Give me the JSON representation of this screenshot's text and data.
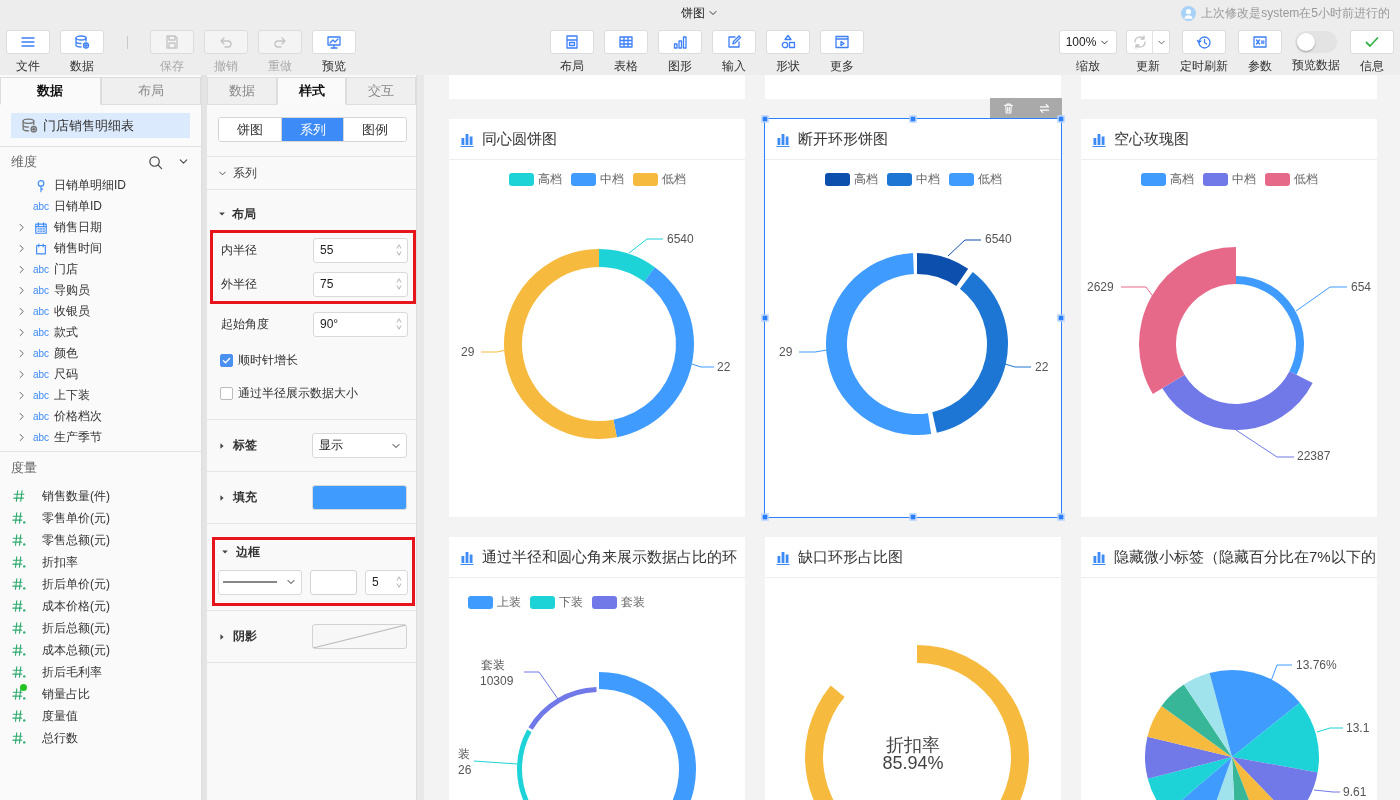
{
  "header": {
    "title": "饼图",
    "last_modified": "上次修改是system在5小时前进行的"
  },
  "toolbar": {
    "left_groups": [
      [
        {
          "kind": "menu",
          "label": "文件",
          "disabled": false
        },
        {
          "kind": "database",
          "label": "数据",
          "disabled": false
        }
      ],
      [
        {
          "kind": "save",
          "label": "保存",
          "disabled": true
        },
        {
          "kind": "undo",
          "label": "撤销",
          "disabled": true
        },
        {
          "kind": "redo",
          "label": "重做",
          "disabled": true
        },
        {
          "kind": "preview",
          "label": "预览",
          "disabled": false
        }
      ]
    ],
    "center": [
      {
        "kind": "layout",
        "label": "布局",
        "disabled": false
      },
      {
        "kind": "table",
        "label": "表格",
        "disabled": false
      },
      {
        "kind": "chart",
        "label": "图形",
        "disabled": false
      },
      {
        "kind": "edit",
        "label": "输入",
        "disabled": false
      },
      {
        "kind": "shapes",
        "label": "形状",
        "disabled": false
      },
      {
        "kind": "more",
        "label": "更多",
        "disabled": false
      }
    ],
    "right": [
      {
        "kind": "dropdown",
        "value": "100%",
        "label": "缩放"
      },
      {
        "kind": "split",
        "label": "更新",
        "disabled": true
      },
      {
        "kind": "clock",
        "label": "定时刷新",
        "disabled": false
      },
      {
        "kind": "formula",
        "label": "参数",
        "disabled": false
      },
      {
        "kind": "toggle",
        "label": "预览数据",
        "on": false
      },
      {
        "kind": "check",
        "label": "信息",
        "disabled": false
      }
    ]
  },
  "data_panel": {
    "tabs": [
      {
        "label": "数据",
        "selected": true
      },
      {
        "label": "布局",
        "selected": false
      }
    ],
    "dataset": {
      "name": "门店销售明细表",
      "selected": true
    },
    "dimensions": {
      "title": "维度",
      "items": [
        {
          "name": "日销单明细ID",
          "kind": "key",
          "expandable": false
        },
        {
          "name": "日销单ID",
          "type_label": "abc",
          "expandable": false
        },
        {
          "name": "销售日期",
          "kind": "calendar",
          "expandable": true
        },
        {
          "name": "销售时间",
          "kind": "time",
          "expandable": true
        },
        {
          "name": "门店",
          "type_label": "abc",
          "expandable": true
        },
        {
          "name": "导购员",
          "type_label": "abc",
          "expandable": true
        },
        {
          "name": "收银员",
          "type_label": "abc",
          "expandable": true
        },
        {
          "name": "款式",
          "type_label": "abc",
          "expandable": true
        },
        {
          "name": "颜色",
          "type_label": "abc",
          "expandable": true
        },
        {
          "name": "尺码",
          "type_label": "abc",
          "expandable": true
        },
        {
          "name": "上下装",
          "type_label": "abc",
          "expandable": true
        },
        {
          "name": "价格档次",
          "type_label": "abc",
          "expandable": true
        },
        {
          "name": "生产季节",
          "type_label": "abc",
          "expandable": true
        }
      ]
    },
    "measures": {
      "title": "度量",
      "items": [
        {
          "name": "销售数量(件)",
          "kind": "hash",
          "flagged": false
        },
        {
          "name": "零售单价(元)",
          "kind": "hash-dot",
          "flagged": false
        },
        {
          "name": "零售总额(元)",
          "kind": "hash-dot",
          "flagged": false
        },
        {
          "name": "折扣率",
          "kind": "hash-dot",
          "flagged": false
        },
        {
          "name": "折后单价(元)",
          "kind": "hash-dot",
          "flagged": false
        },
        {
          "name": "成本价格(元)",
          "kind": "hash-dot",
          "flagged": false
        },
        {
          "name": "折后总额(元)",
          "kind": "hash-dot",
          "flagged": false
        },
        {
          "name": "成本总额(元)",
          "kind": "hash-dot",
          "flagged": false
        },
        {
          "name": "折后毛利率",
          "kind": "hash-dot",
          "flagged": false
        },
        {
          "name": "销量占比",
          "kind": "hash-dot",
          "flagged": true
        },
        {
          "name": "度量值",
          "kind": "hash-dot",
          "flagged": false
        },
        {
          "name": "总行数",
          "kind": "hash-dot",
          "flagged": false
        }
      ]
    }
  },
  "style_panel": {
    "tabs": [
      {
        "label": "数据",
        "selected": false
      },
      {
        "label": "样式",
        "selected": true
      },
      {
        "label": "交互",
        "selected": false
      }
    ],
    "segments": [
      {
        "label": "饼图",
        "selected": false
      },
      {
        "label": "系列",
        "selected": true
      },
      {
        "label": "图例",
        "selected": false
      }
    ],
    "sections": [
      {
        "kind": "category",
        "title": "系列",
        "expanded": true
      },
      {
        "kind": "layout",
        "title": "布局",
        "expanded": true,
        "field_groups": [
          {
            "highlighted": true,
            "rows": [
              {
                "label": "内半径",
                "value": "55"
              },
              {
                "label": "外半径",
                "value": "75"
              }
            ]
          },
          {
            "highlighted": false,
            "rows": [
              {
                "label": "起始角度",
                "value": "90°"
              }
            ]
          }
        ],
        "checkboxes": [
          {
            "label": "顺时针增长",
            "checked": true
          },
          {
            "label": "通过半径展示数据大小",
            "checked": false
          }
        ]
      },
      {
        "kind": "property",
        "title": "标签",
        "expanded": false,
        "control": {
          "kind": "select",
          "value": "显示"
        }
      },
      {
        "kind": "property",
        "title": "填充",
        "expanded": false,
        "control": {
          "kind": "color",
          "color": "#409bff"
        }
      },
      {
        "kind": "border",
        "title": "边框",
        "expanded": true,
        "highlighted": true,
        "controls": [
          {
            "kind": "line-style"
          },
          {
            "kind": "color",
            "color": "#ffffff"
          },
          {
            "kind": "spin",
            "value": "5"
          }
        ]
      },
      {
        "kind": "property",
        "title": "阴影",
        "expanded": false,
        "control": {
          "kind": "shadow"
        }
      }
    ]
  },
  "canvas": {
    "cards_above": [
      {
        "kind": "blank"
      },
      {
        "kind": "blank"
      },
      {
        "kind": "blank"
      }
    ],
    "charts": [
      {
        "title": "同心圆饼图",
        "kind": "ring",
        "selected": false,
        "legend": [
          {
            "label": "高档",
            "color": "#1dd3d8"
          },
          {
            "label": "中档",
            "color": "#409bff"
          },
          {
            "label": "低档",
            "color": "#f6ba3e"
          }
        ],
        "labels": [
          "6540",
          "22",
          "29"
        ]
      },
      {
        "title": "断开环形饼图",
        "kind": "broken",
        "selected": true,
        "legend": [
          {
            "label": "高档",
            "color": "#0d4fad"
          },
          {
            "label": "中档",
            "color": "#1d76d3"
          },
          {
            "label": "低档",
            "color": "#409bff"
          }
        ],
        "labels": [
          "6540",
          "22",
          "29"
        ]
      },
      {
        "title": "空心玫瑰图",
        "kind": "rose",
        "selected": false,
        "legend": [
          {
            "label": "高档",
            "color": "#409bff"
          },
          {
            "label": "中档",
            "color": "#7079e7"
          },
          {
            "label": "低档",
            "color": "#e7698a"
          }
        ],
        "labels": [
          "654",
          "22387",
          "2629"
        ]
      },
      {
        "title": "通过半径和圆心角来展示数据占比的环",
        "kind": "radius",
        "selected": false,
        "legend": [
          {
            "label": "上装",
            "color": "#409bff"
          },
          {
            "label": "下装",
            "color": "#1dd3d8"
          },
          {
            "label": "套装",
            "color": "#7079e7"
          }
        ],
        "labels": [
          "套装",
          "10309",
          "装",
          "26"
        ]
      },
      {
        "title": "缺口环形占比图",
        "kind": "gauge",
        "selected": false,
        "center_label": "折扣率",
        "center_value": "85.94%"
      },
      {
        "title": "隐藏微小标签（隐藏百分比在7%以下的",
        "kind": "pie",
        "selected": false,
        "labels": [
          "13.76%",
          "13.1",
          "9.61"
        ]
      }
    ]
  }
}
